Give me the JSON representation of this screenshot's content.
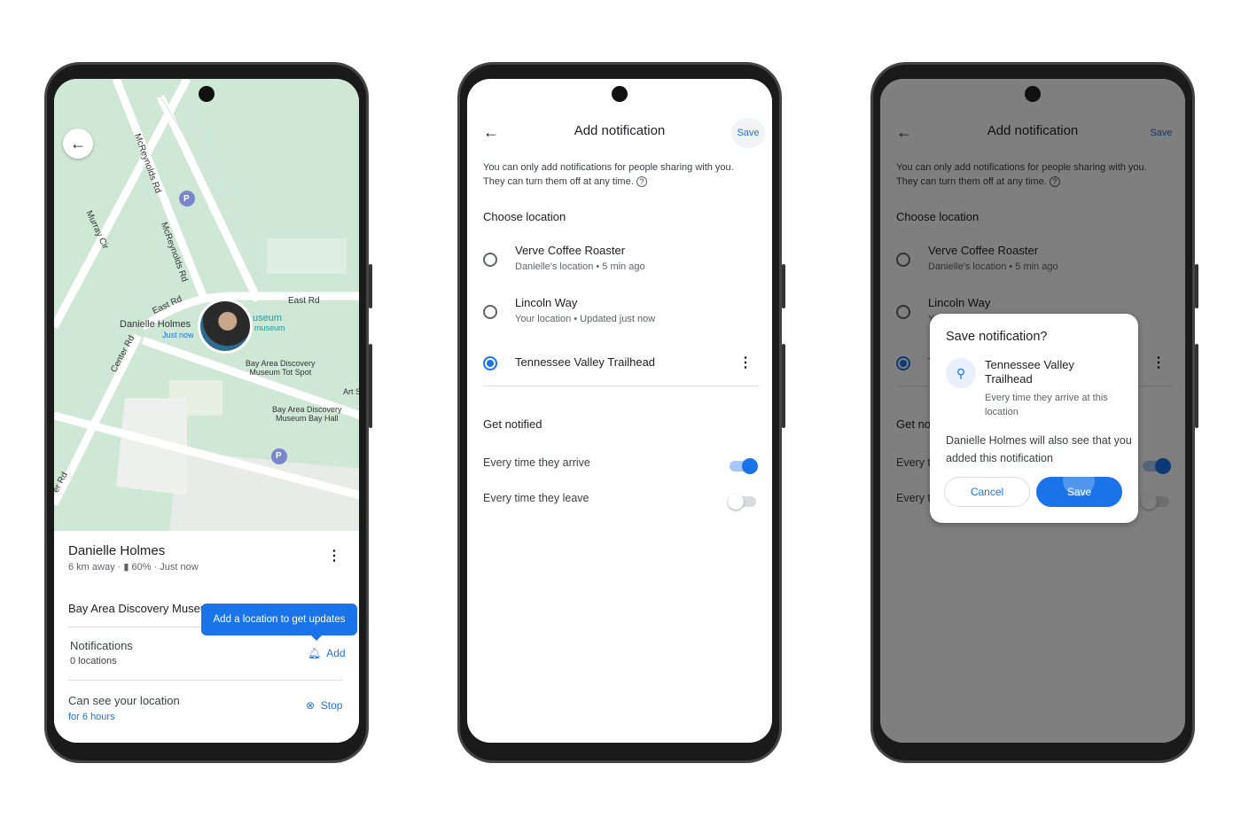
{
  "phone1": {
    "map_labels": {
      "mcreynolds1": "McReynolds Rd",
      "mcreynolds2": "McReynolds Rd",
      "murray": "Murray Cir",
      "east1": "East Rd",
      "east2": "East Rd",
      "center": "Center Rd",
      "museum": "useum",
      "museum_sub": "museum",
      "tot_spot": "Bay Area Discovery\nMuseum Tot Spot",
      "bay_hall": "Bay Area Discovery\nMuseum Bay Hall",
      "art": "Art S",
      "er_rd": "er Rd",
      "parking": "P"
    },
    "person_label": "Danielle Holmes",
    "person_time": "Just now",
    "name": "Danielle Holmes",
    "meta": "6 km away ·",
    "battery": "60% · Just now",
    "place": "Bay Area Discovery Museum",
    "tooltip": "Add a location to get updates",
    "notifications_label": "Notifications",
    "notifications_count": "0 locations",
    "add_label": "Add",
    "sharing_label": "Can see your location",
    "sharing_duration": "for 6 hours",
    "stop_label": "Stop"
  },
  "notif": {
    "title": "Add notification",
    "save": "Save",
    "info": "You can only add notifications for people sharing with you. They can turn them off at any time.",
    "choose_location": "Choose location",
    "locations": [
      {
        "name": "Verve Coffee Roaster",
        "detail": "Danielle's location • 5 min ago",
        "selected": false
      },
      {
        "name": "Lincoln Way",
        "detail": "Your location • Updated just now",
        "selected": false
      },
      {
        "name": "Tennessee Valley Trailhead",
        "detail": "",
        "selected": true
      }
    ],
    "get_notified": "Get notified",
    "options": [
      {
        "label": "Every time they arrive",
        "on": true
      },
      {
        "label": "Every time they leave",
        "on": false
      }
    ]
  },
  "dialog": {
    "title": "Save notification?",
    "place": "Tennessee Valley Trailhead",
    "place_detail": "Every time they arrive at this location",
    "message": "Danielle Holmes will also see that you added this notification",
    "cancel": "Cancel",
    "save": "Save"
  },
  "colors": {
    "accent": "#1a73e8",
    "map": "#cfe8d6"
  }
}
